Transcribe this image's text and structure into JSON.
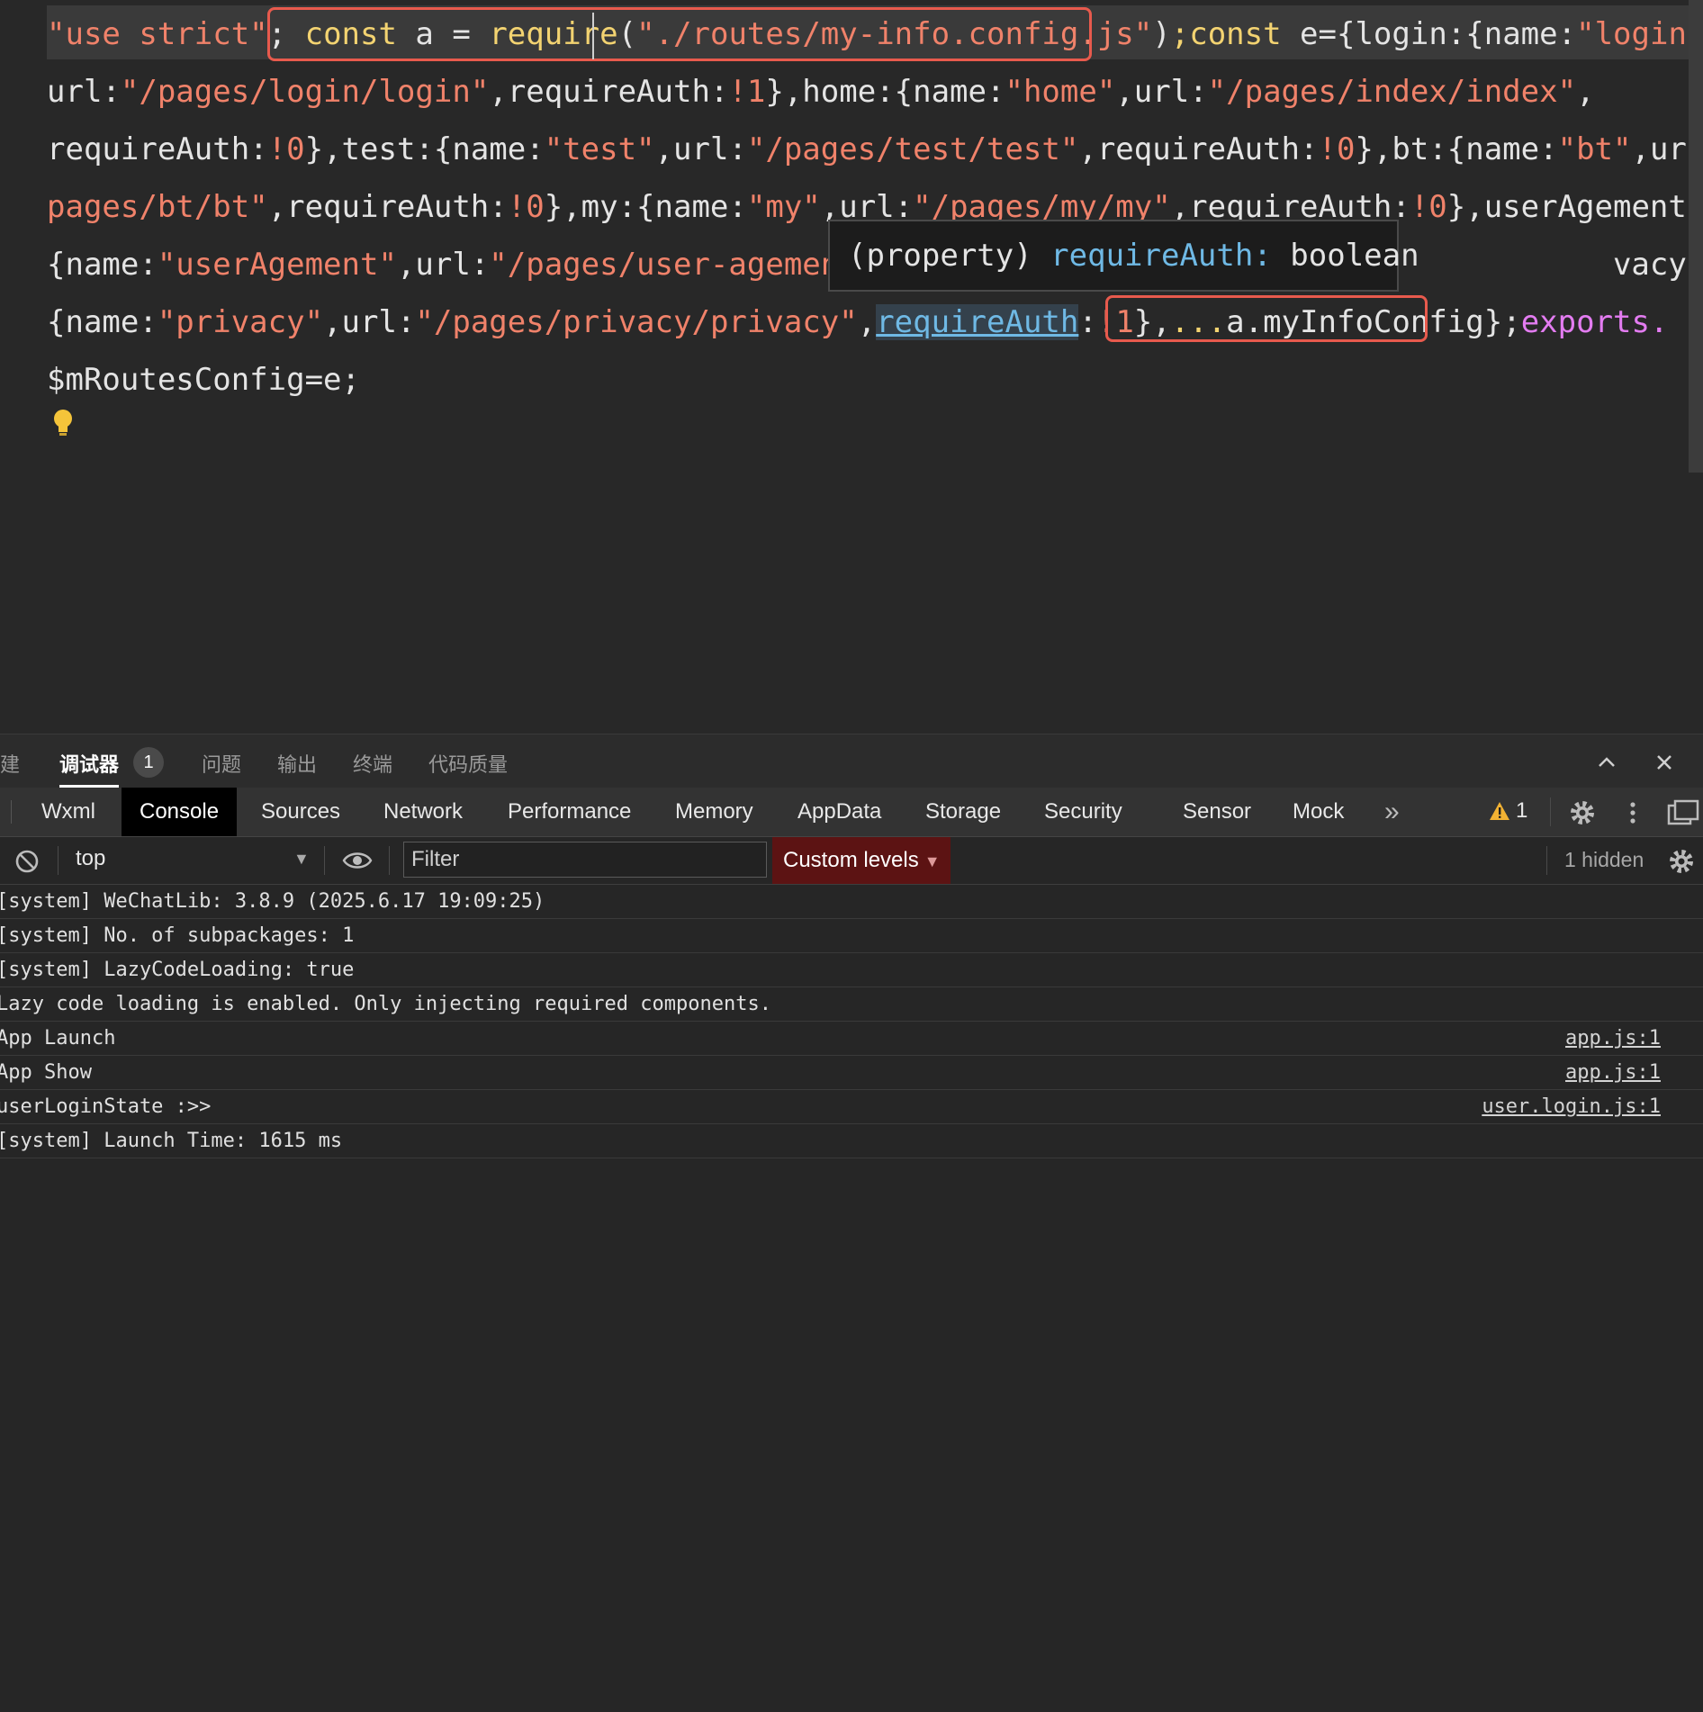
{
  "editor": {
    "lines": [
      [
        [
          "s",
          "\"use strict\""
        ],
        [
          "",
          "; "
        ],
        [
          "k",
          "const"
        ],
        [
          "",
          " a = "
        ],
        [
          "k",
          "require"
        ],
        [
          "",
          "("
        ],
        [
          "s",
          "\"./routes/my-info.config.js\""
        ],
        [
          "",
          ")"
        ],
        [
          "k",
          ";"
        ],
        [
          "k",
          "const"
        ],
        [
          "",
          " e={login:{name:"
        ],
        [
          "s",
          "\"login\""
        ],
        [
          "",
          ","
        ]
      ],
      [
        [
          "",
          "url:"
        ],
        [
          "s",
          "\"/pages/login/login\""
        ],
        [
          "",
          ",requireAuth:"
        ],
        [
          "s",
          "!1"
        ],
        [
          "",
          "},home:{name:"
        ],
        [
          "s",
          "\"home\""
        ],
        [
          "",
          ",url:"
        ],
        [
          "s",
          "\"/pages/index/index\""
        ],
        [
          "",
          ","
        ]
      ],
      [
        [
          "",
          "requireAuth:"
        ],
        [
          "s",
          "!0"
        ],
        [
          "",
          "},test:{name:"
        ],
        [
          "s",
          "\"test\""
        ],
        [
          "",
          ",url:"
        ],
        [
          "s",
          "\"/pages/test/test\""
        ],
        [
          "",
          ",requireAuth:"
        ],
        [
          "s",
          "!0"
        ],
        [
          "",
          "},bt:{name:"
        ],
        [
          "s",
          "\"bt\""
        ],
        [
          "",
          ",url:"
        ],
        [
          "s",
          "\"/"
        ]
      ],
      [
        [
          "s",
          "pages/bt/bt\""
        ],
        [
          "",
          ",requireAuth:"
        ],
        [
          "s",
          "!0"
        ],
        [
          "",
          "},my:{name:"
        ],
        [
          "s",
          "\"my\""
        ],
        [
          "",
          ",url:"
        ],
        [
          "s",
          "\"/pages/my/my\""
        ],
        [
          "",
          ",requireAuth:"
        ],
        [
          "s",
          "!0"
        ],
        [
          "",
          "},userAgement:"
        ]
      ],
      [
        [
          "",
          "{name:"
        ],
        [
          "s",
          "\"userAgement\""
        ],
        [
          "",
          ",url:"
        ],
        [
          "s",
          "\"/pages/user-agement/"
        ],
        [
          "",
          "                                        vacy:"
        ]
      ],
      [
        [
          "",
          "{name:"
        ],
        [
          "s",
          "\"privacy\""
        ],
        [
          "",
          ",url:"
        ],
        [
          "s",
          "\"/pages/privacy/privacy\""
        ],
        [
          "",
          ","
        ],
        [
          "h",
          "requireAuth"
        ],
        [
          "",
          ":"
        ],
        [
          "s",
          "!1"
        ],
        [
          "",
          "},"
        ],
        [
          "k",
          "..."
        ],
        [
          "",
          "a.myInfoConfig}"
        ],
        [
          "",
          ";"
        ],
        [
          "e",
          "exports."
        ]
      ],
      [
        [
          "",
          "$mRoutesConfig=e;"
        ]
      ]
    ],
    "tooltip": {
      "prefix": "(property) ",
      "name": "requireAuth:",
      "type": " boolean"
    }
  },
  "panel": {
    "tabs": [
      "构建",
      "调试器",
      "问题",
      "输出",
      "终端",
      "代码质量"
    ],
    "badge": "1"
  },
  "devtools": {
    "tabs": [
      "Wxml",
      "Console",
      "Sources",
      "Network",
      "Performance",
      "Memory",
      "AppData",
      "Storage",
      "Security",
      "Sensor",
      "Mock"
    ],
    "more": "»",
    "warning_count": "1"
  },
  "console_toolbar": {
    "context": "top",
    "filter_placeholder": "Filter",
    "levels": "Custom levels",
    "hidden": "1 hidden"
  },
  "console": [
    {
      "msg": "[system] WeChatLib: 3.8.9 (2025.6.17 19:09:25)",
      "src": ""
    },
    {
      "msg": "[system] No. of subpackages: 1",
      "src": ""
    },
    {
      "msg": "[system] LazyCodeLoading: true",
      "src": ""
    },
    {
      "msg": "Lazy code loading is enabled. Only injecting required components.",
      "src": ""
    },
    {
      "msg": "App Launch",
      "src": "app.js:1"
    },
    {
      "msg": "App Show",
      "src": "app.js:1"
    },
    {
      "msg": "userLoginState :>>",
      "src": "user.login.js:1"
    },
    {
      "msg": "[system] Launch Time: 1615 ms",
      "src": ""
    }
  ],
  "colors": {
    "string": "#f0826a",
    "keyword": "#f3d371",
    "property": "#6fb9e5",
    "highlight_box": "#e85a4d",
    "levels_bg": "#5c1313"
  }
}
